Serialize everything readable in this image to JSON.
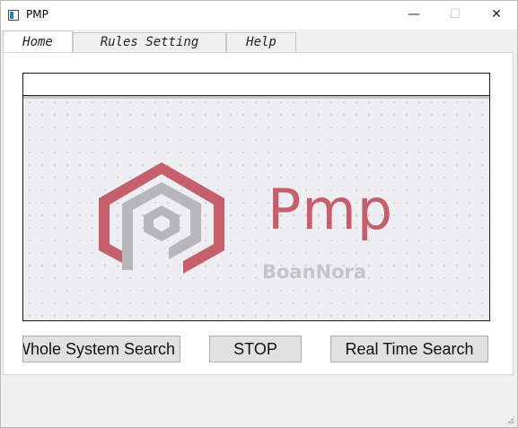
{
  "window": {
    "title": "PMP",
    "minimize_glyph": "—",
    "maximize_glyph": "☐",
    "close_glyph": "✕"
  },
  "tabs": [
    {
      "label": "Home",
      "active": true
    },
    {
      "label": "Rules Setting",
      "active": false
    },
    {
      "label": "Help",
      "active": false
    }
  ],
  "home": {
    "status_input": {
      "value": ""
    },
    "logo": {
      "brand_name": "Pmp",
      "brand_sub": "BoanNora",
      "colors": {
        "primary": "#c3606c",
        "secondary": "#b7b7b9",
        "text_sub": "#c5c5c7"
      }
    },
    "buttons": {
      "whole_system_search": "Whole System Search",
      "stop": "STOP",
      "real_time_search": "Real Time Search"
    }
  }
}
